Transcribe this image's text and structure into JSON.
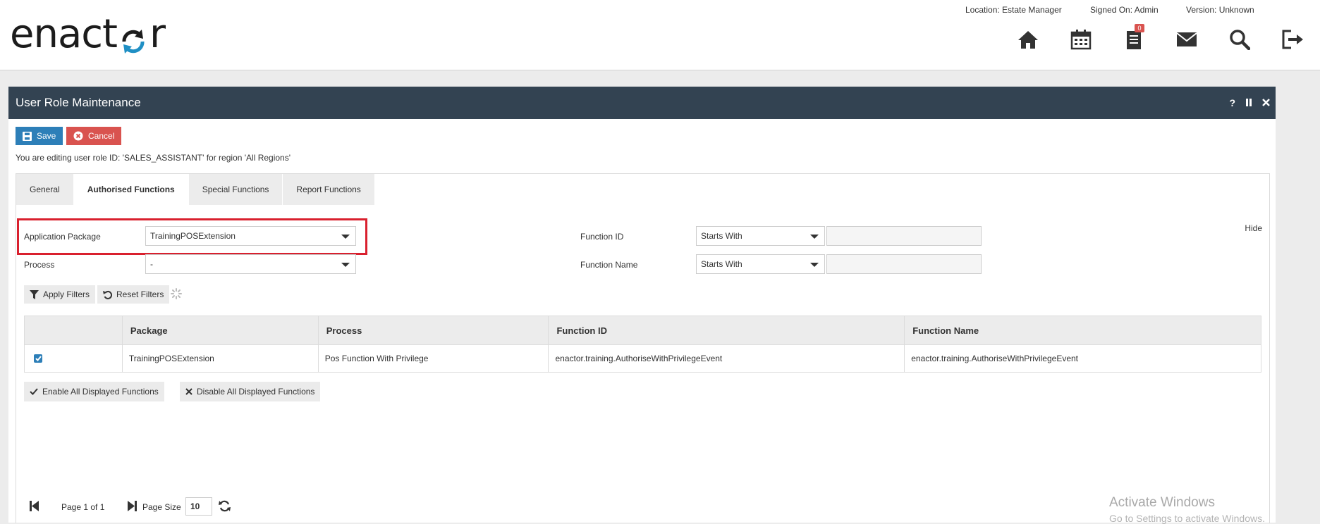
{
  "header": {
    "logo_text_start": "enact",
    "logo_text_end": "r",
    "location": "Location: Estate Manager",
    "signed_on": "Signed On: Admin",
    "version": "Version: Unknown",
    "documents_badge": "0",
    "icons": [
      "home-icon",
      "calendar-icon",
      "documents-icon",
      "mail-icon",
      "search-icon",
      "logout-icon"
    ]
  },
  "panel": {
    "title": "User Role Maintenance",
    "help": "?",
    "save_label": "Save",
    "cancel_label": "Cancel",
    "editing_message": "You are editing user role ID: 'SALES_ASSISTANT' for region 'All Regions'",
    "tabs": [
      {
        "label": "General",
        "active": false
      },
      {
        "label": "Authorised Functions",
        "active": true
      },
      {
        "label": "Special Functions",
        "active": false
      },
      {
        "label": "Report Functions",
        "active": false
      }
    ]
  },
  "filters": {
    "application_package_label": "Application Package",
    "application_package_value": "TrainingPOSExtension",
    "process_label": "Process",
    "process_value": "-",
    "function_id_label": "Function ID",
    "function_id_mode": "Starts With",
    "function_id_value": "",
    "function_name_label": "Function Name",
    "function_name_mode": "Starts With",
    "function_name_value": "",
    "hide_label": "Hide",
    "apply_label": "Apply Filters",
    "reset_label": "Reset Filters"
  },
  "grid": {
    "columns": [
      "",
      "Package",
      "Process",
      "Function ID",
      "Function Name"
    ],
    "rows": [
      {
        "checked": true,
        "package": "TrainingPOSExtension",
        "process": "Pos Function With Privilege",
        "function_id": "enactor.training.AuthoriseWithPrivilegeEvent",
        "function_name": "enactor.training.AuthoriseWithPrivilegeEvent"
      }
    ]
  },
  "actions": {
    "enable_all": "Enable All Displayed Functions",
    "disable_all": "Disable All Displayed Functions"
  },
  "pager": {
    "page_text": "Page 1 of 1",
    "page_size_label": "Page Size",
    "page_size": "10"
  },
  "watermark": {
    "line1": "Activate Windows",
    "line2": "Go to Settings to activate Windows."
  },
  "colors": {
    "title_bar": "#334352",
    "save": "#2d7fb8",
    "cancel": "#d9534f",
    "highlight": "#d9202e",
    "logo_accent": "#1f8fc4"
  }
}
